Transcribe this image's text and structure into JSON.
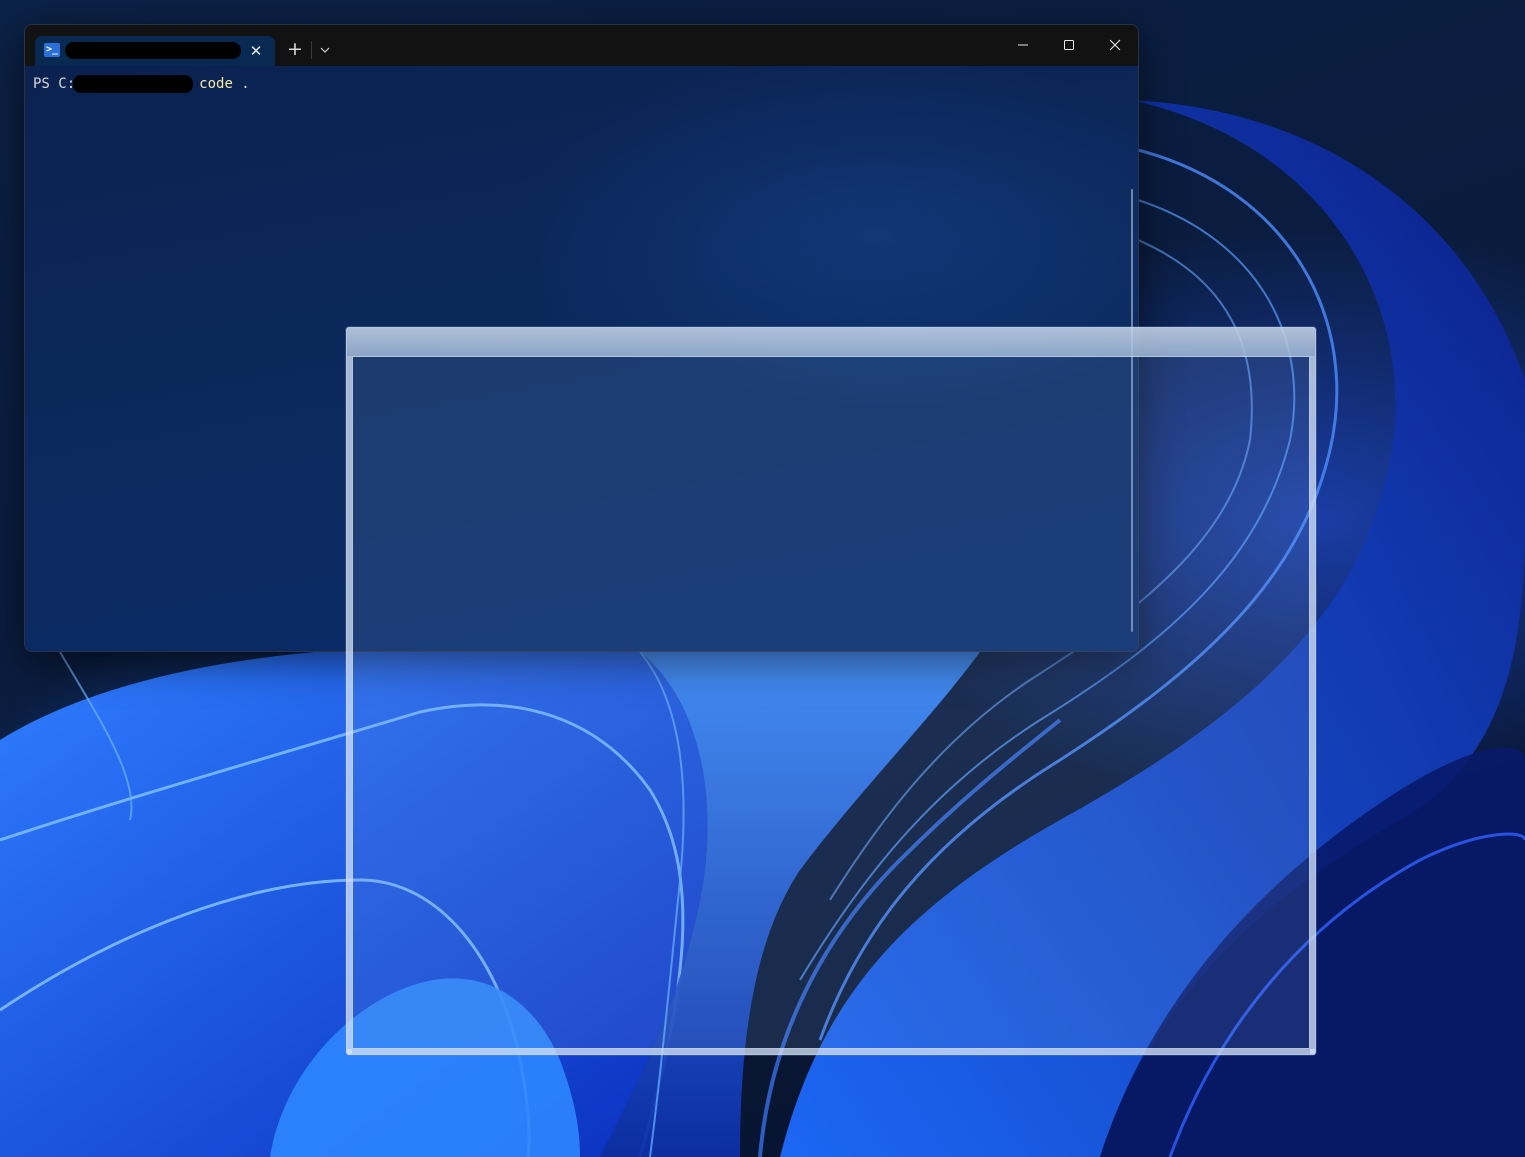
{
  "desktop": {
    "wallpaper_name": "windows-11-bloom",
    "colors": {
      "background": "#061633",
      "accent": "#1f4dff"
    }
  },
  "terminal": {
    "tab": {
      "icon": "powershell-icon",
      "title": "",
      "close_glyph": "✕"
    },
    "new_tab_glyph": "+",
    "dropdown_icon": "chevron-down-icon",
    "window_controls": {
      "minimize_icon": "minimize-icon",
      "maximize_icon": "maximize-icon",
      "close_icon": "close-icon"
    },
    "prompt": {
      "prefix": "PS C:",
      "path": "",
      "command": "code",
      "argument": " ."
    },
    "colors": {
      "titlebar": "#121212",
      "tab": "#082a52",
      "body": "#0b2a5e",
      "command_text": "#f3e9a8"
    }
  },
  "ghost_window": {
    "description_kind": "drag-preview-frame"
  }
}
